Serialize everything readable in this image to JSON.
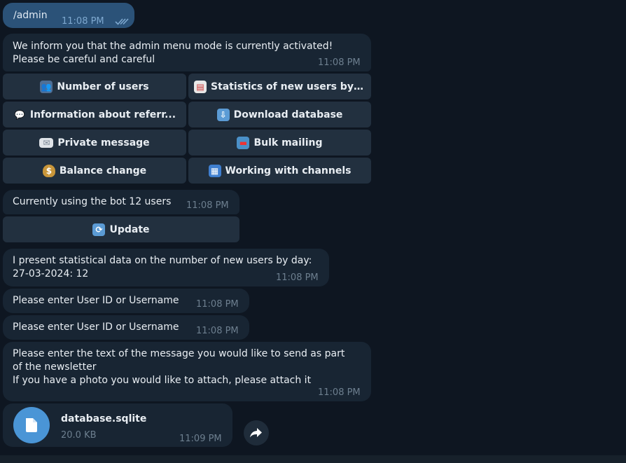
{
  "outgoing": {
    "text": "/admin",
    "time": "11:08 PM"
  },
  "admin_notice": {
    "text": "We inform you that the admin menu mode is currently activated!\nPlease be careful and careful",
    "time": "11:08 PM"
  },
  "admin_keyboard": [
    {
      "label": "Number of users",
      "icon": "users-icon"
    },
    {
      "label": "Statistics of new users by ...",
      "icon": "calendar-icon"
    },
    {
      "label": "Information about referr...",
      "icon": "speech-bubble-icon"
    },
    {
      "label": "Download database",
      "icon": "download-icon"
    },
    {
      "label": "Private message",
      "icon": "envelope-icon"
    },
    {
      "label": "Bulk mailing",
      "icon": "mailbox-icon"
    },
    {
      "label": "Balance change",
      "icon": "money-bag-icon"
    },
    {
      "label": "Working with channels",
      "icon": "elevator-icon"
    }
  ],
  "users_count": {
    "text": "Currently using the bot 12 users",
    "time": "11:08 PM"
  },
  "update_button": {
    "label": "Update",
    "icon": "refresh-icon"
  },
  "stats": {
    "text": "I present statistical data on the number of new users by day:\n27-03-2024: 12",
    "time": "11:08 PM"
  },
  "prompt1": {
    "text": "Please enter  User ID or Username",
    "time": "11:08 PM"
  },
  "prompt2": {
    "text": "Please enter  User ID or Username",
    "time": "11:08 PM"
  },
  "newsletter": {
    "text": "Please enter the text of the message you would like to send as part\nof the newsletter\nIf you have a photo you would like to attach, please attach it",
    "time": "11:08 PM"
  },
  "file": {
    "name": "database.sqlite",
    "size": "20.0 KB",
    "time": "11:09 PM"
  },
  "colors": {
    "background": "#0e1621",
    "incoming": "#182533",
    "outgoing": "#2b5278",
    "button": "#22303f",
    "accent": "#4a95d6"
  }
}
